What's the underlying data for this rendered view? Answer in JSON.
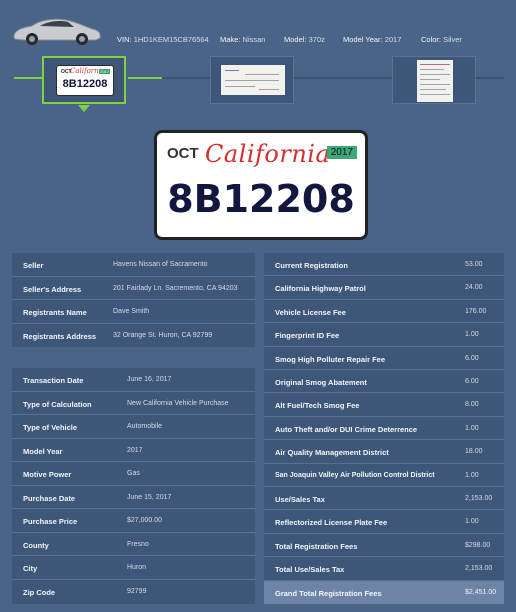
{
  "vehicle": {
    "vin_label": "VIN:",
    "vin": "1HD1KEM15CB76564",
    "make_label": "Make:",
    "make": "Nissan",
    "model_label": "Model:",
    "model": "370z",
    "year_label": "Model Year:",
    "year": "2017",
    "color_label": "Color:",
    "color": "Silver"
  },
  "plate": {
    "month": "OCT",
    "state": "California",
    "year": "2017",
    "number": "8B12208"
  },
  "seller_info": [
    {
      "label": "Seller",
      "value": "Havens Nissan of Sacramento"
    },
    {
      "label": "Seller's Address",
      "value": "201 Fairlady Ln. Sacremento, CA 94203"
    },
    {
      "label": "Registrants Name",
      "value": "Dave Smith"
    },
    {
      "label": "Registrants Address",
      "value": "32 Orange St. Huron, CA 92799"
    }
  ],
  "transaction_info": [
    {
      "label": "Transaction Date",
      "value": "June 16, 2017"
    },
    {
      "label": "Type of Calculation",
      "value": "New California Vehicle Purchase"
    },
    {
      "label": "Type of Vehicle",
      "value": "Automobile"
    },
    {
      "label": "Model Year",
      "value": "2017"
    },
    {
      "label": "Motive Power",
      "value": "Gas"
    },
    {
      "label": "Purchase Date",
      "value": "June 15, 2017"
    },
    {
      "label": "Purchase Price",
      "value": "$27,000.00"
    },
    {
      "label": "County",
      "value": "Fresno"
    },
    {
      "label": "City",
      "value": "Huron"
    },
    {
      "label": "Zip Code",
      "value": "92799"
    }
  ],
  "fees": [
    {
      "label": "Current Registration",
      "value": "53.00"
    },
    {
      "label": "California Highway Patrol",
      "value": "24.00"
    },
    {
      "label": "Vehicle License Fee",
      "value": "176.00"
    },
    {
      "label": "Fingerprint ID Fee",
      "value": "1.00"
    },
    {
      "label": "Smog High Polluter Repair Fee",
      "value": "6.00"
    },
    {
      "label": "Original Smog Abatement",
      "value": "6.00"
    },
    {
      "label": "Alt Fuel/Tech Smog Fee",
      "value": "8.00"
    },
    {
      "label": "Auto Theft and/or DUI Crime Deterrence",
      "value": "1.00"
    },
    {
      "label": "Air Quality Management District",
      "value": "18.00"
    },
    {
      "label": "San Joaquin Valley Air Pollution Control District",
      "value": "1.00"
    },
    {
      "label": "Use/Sales Tax",
      "value": "2,153.00"
    },
    {
      "label": "Reflectorized License Plate Fee",
      "value": "1.00"
    },
    {
      "label": "Total Registration Fees",
      "value": "$298.00"
    },
    {
      "label": "Total Use/Sales Tax",
      "value": "2,153.00"
    },
    {
      "label": "Grand Total Registration Fees",
      "value": "$2,451.00"
    }
  ],
  "colors": {
    "background": "#4a6488",
    "panel": "#3e5678",
    "accent": "#7dd13f",
    "highlight_row": "#6d84a6"
  }
}
